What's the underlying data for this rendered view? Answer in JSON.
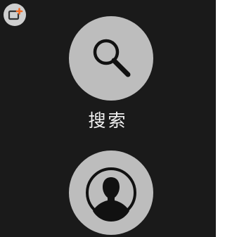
{
  "actions": {
    "search": {
      "label": "搜索",
      "icon": "magnifier-icon"
    },
    "contact": {
      "icon": "person-silhouette-icon"
    }
  },
  "corner_indicator": {
    "icon": "screen-share-icon",
    "accent_color": "#f26a21"
  },
  "colors": {
    "background": "#1a1a1a",
    "button": "#bdbdbd",
    "icon": "#111111",
    "label": "#f2f2f2"
  }
}
